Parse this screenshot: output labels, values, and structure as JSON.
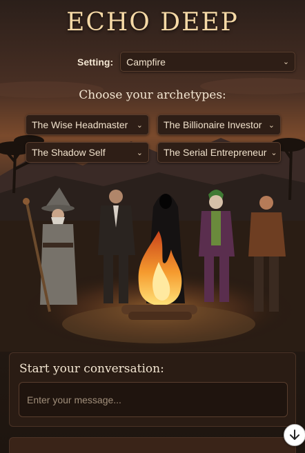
{
  "app": {
    "title": "ECHO DEEP"
  },
  "setting": {
    "label": "Setting:",
    "value": "Campfire"
  },
  "archetypes": {
    "heading": "Choose your archetypes:",
    "selections": [
      {
        "value": "The Wise Headmaster"
      },
      {
        "value": "The Billionaire Investor"
      },
      {
        "value": "The Shadow Self"
      },
      {
        "value": "The Serial Entrepreneur"
      }
    ]
  },
  "conversation": {
    "heading": "Start your conversation:",
    "placeholder": "Enter your message..."
  },
  "icons": {
    "dropdown": "chevron-down-icon",
    "scroll": "arrow-down-icon"
  },
  "colors": {
    "title": "#f6d9a6",
    "panel": "#2a1c14",
    "fire": "#f08a2c"
  }
}
